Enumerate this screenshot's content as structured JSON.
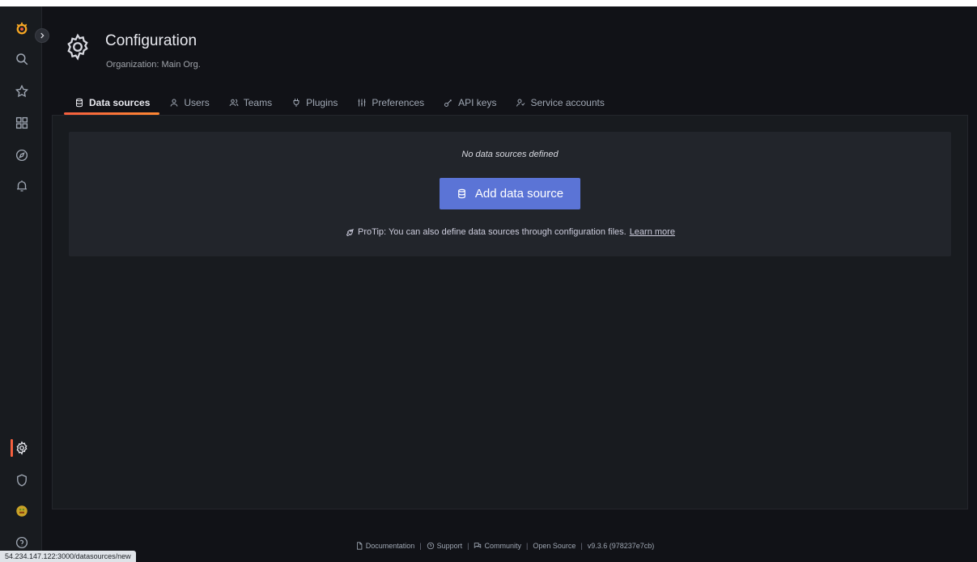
{
  "header": {
    "title": "Configuration",
    "subtitle": "Organization: Main Org."
  },
  "tabs": [
    {
      "label": "Data sources",
      "icon": "database-icon",
      "active": true
    },
    {
      "label": "Users",
      "icon": "user-icon",
      "active": false
    },
    {
      "label": "Teams",
      "icon": "users-icon",
      "active": false
    },
    {
      "label": "Plugins",
      "icon": "plug-icon",
      "active": false
    },
    {
      "label": "Preferences",
      "icon": "sliders-icon",
      "active": false
    },
    {
      "label": "API keys",
      "icon": "key-icon",
      "active": false
    },
    {
      "label": "Service accounts",
      "icon": "service-account-icon",
      "active": false
    }
  ],
  "empty_state": {
    "title": "No data sources defined",
    "button_label": "Add data source",
    "protip_text": "ProTip: You can also define data sources through configuration files.",
    "learn_more": "Learn more"
  },
  "footer": {
    "documentation": "Documentation",
    "support": "Support",
    "community": "Community",
    "open_source": "Open Source",
    "version": "v9.3.6 (978237e7cb)",
    "separator": "|"
  },
  "statusbar": {
    "url": "54.234.147.122:3000/datasources/new"
  },
  "colors": {
    "accent": "#f55f3e",
    "primary_button": "#5b74d6",
    "background": "#111217",
    "panel": "#181b1f"
  }
}
